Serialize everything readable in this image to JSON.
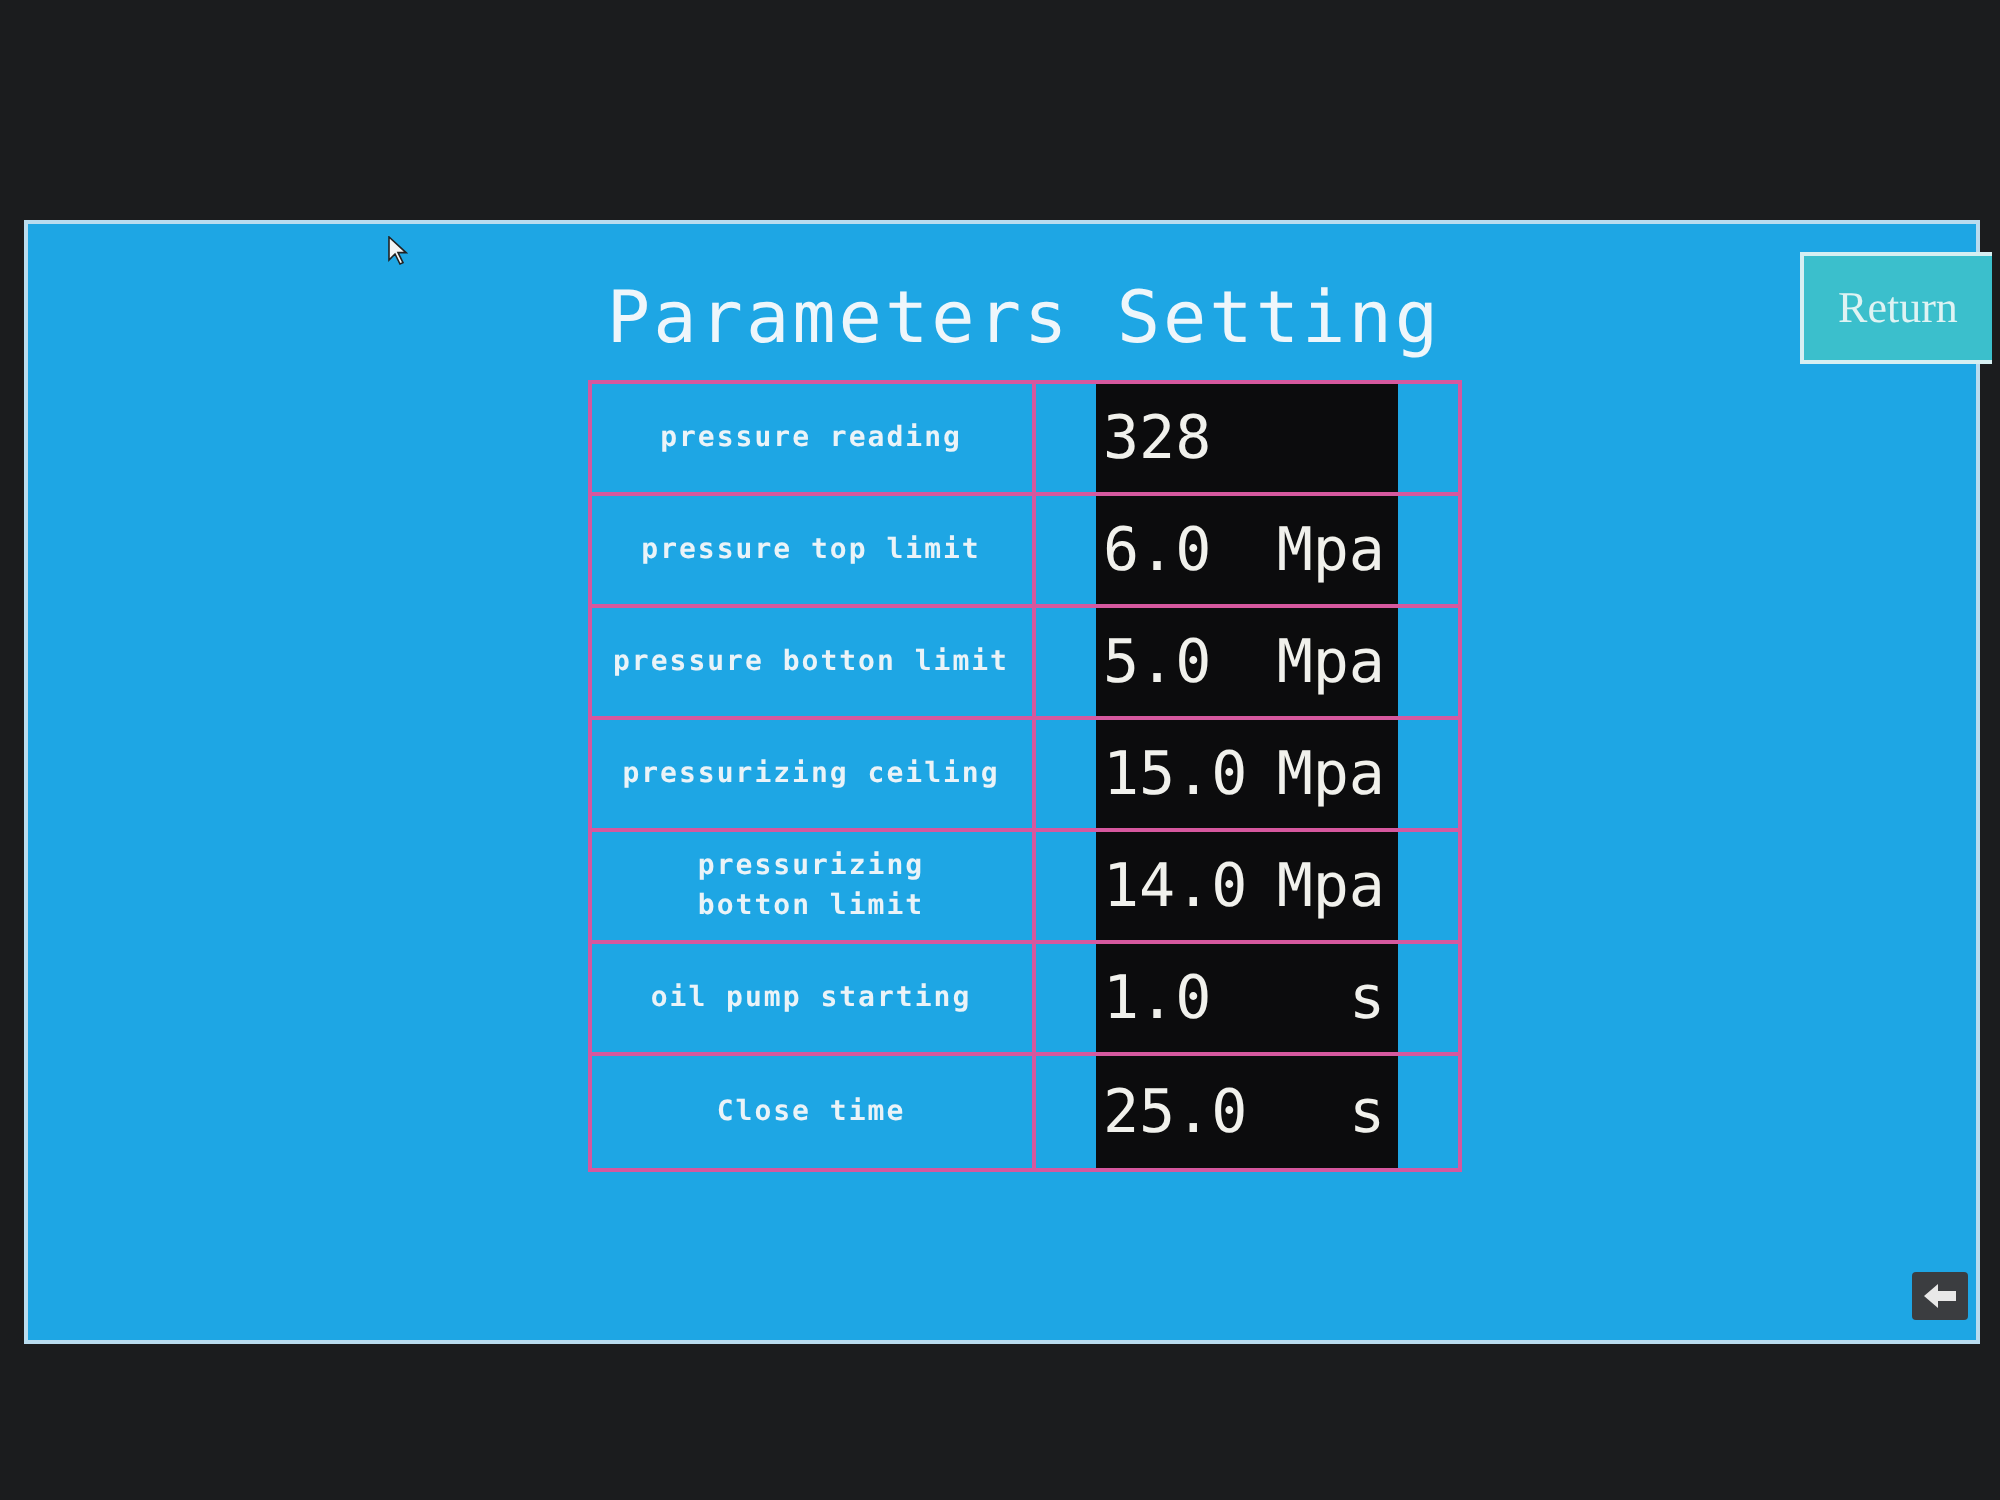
{
  "screen": {
    "title": "Parameters Setting",
    "return_button": "Return",
    "parameters": [
      {
        "label": "pressure reading",
        "value": "328"
      },
      {
        "label": "pressure top limit",
        "value": "6.0",
        "unit": "Mpa"
      },
      {
        "label": "pressure botton limit",
        "value": "5.0",
        "unit": "Mpa"
      },
      {
        "label": "pressurizing ceiling",
        "value": "15.0",
        "unit": "Mpa"
      },
      {
        "label": "pressurizing\nbotton limit",
        "value": "14.0",
        "unit": "Mpa"
      },
      {
        "label": "oil pump starting",
        "value": "1.0",
        "unit": "s"
      },
      {
        "label": "Close time",
        "value": "25.0",
        "unit": "s"
      }
    ]
  }
}
